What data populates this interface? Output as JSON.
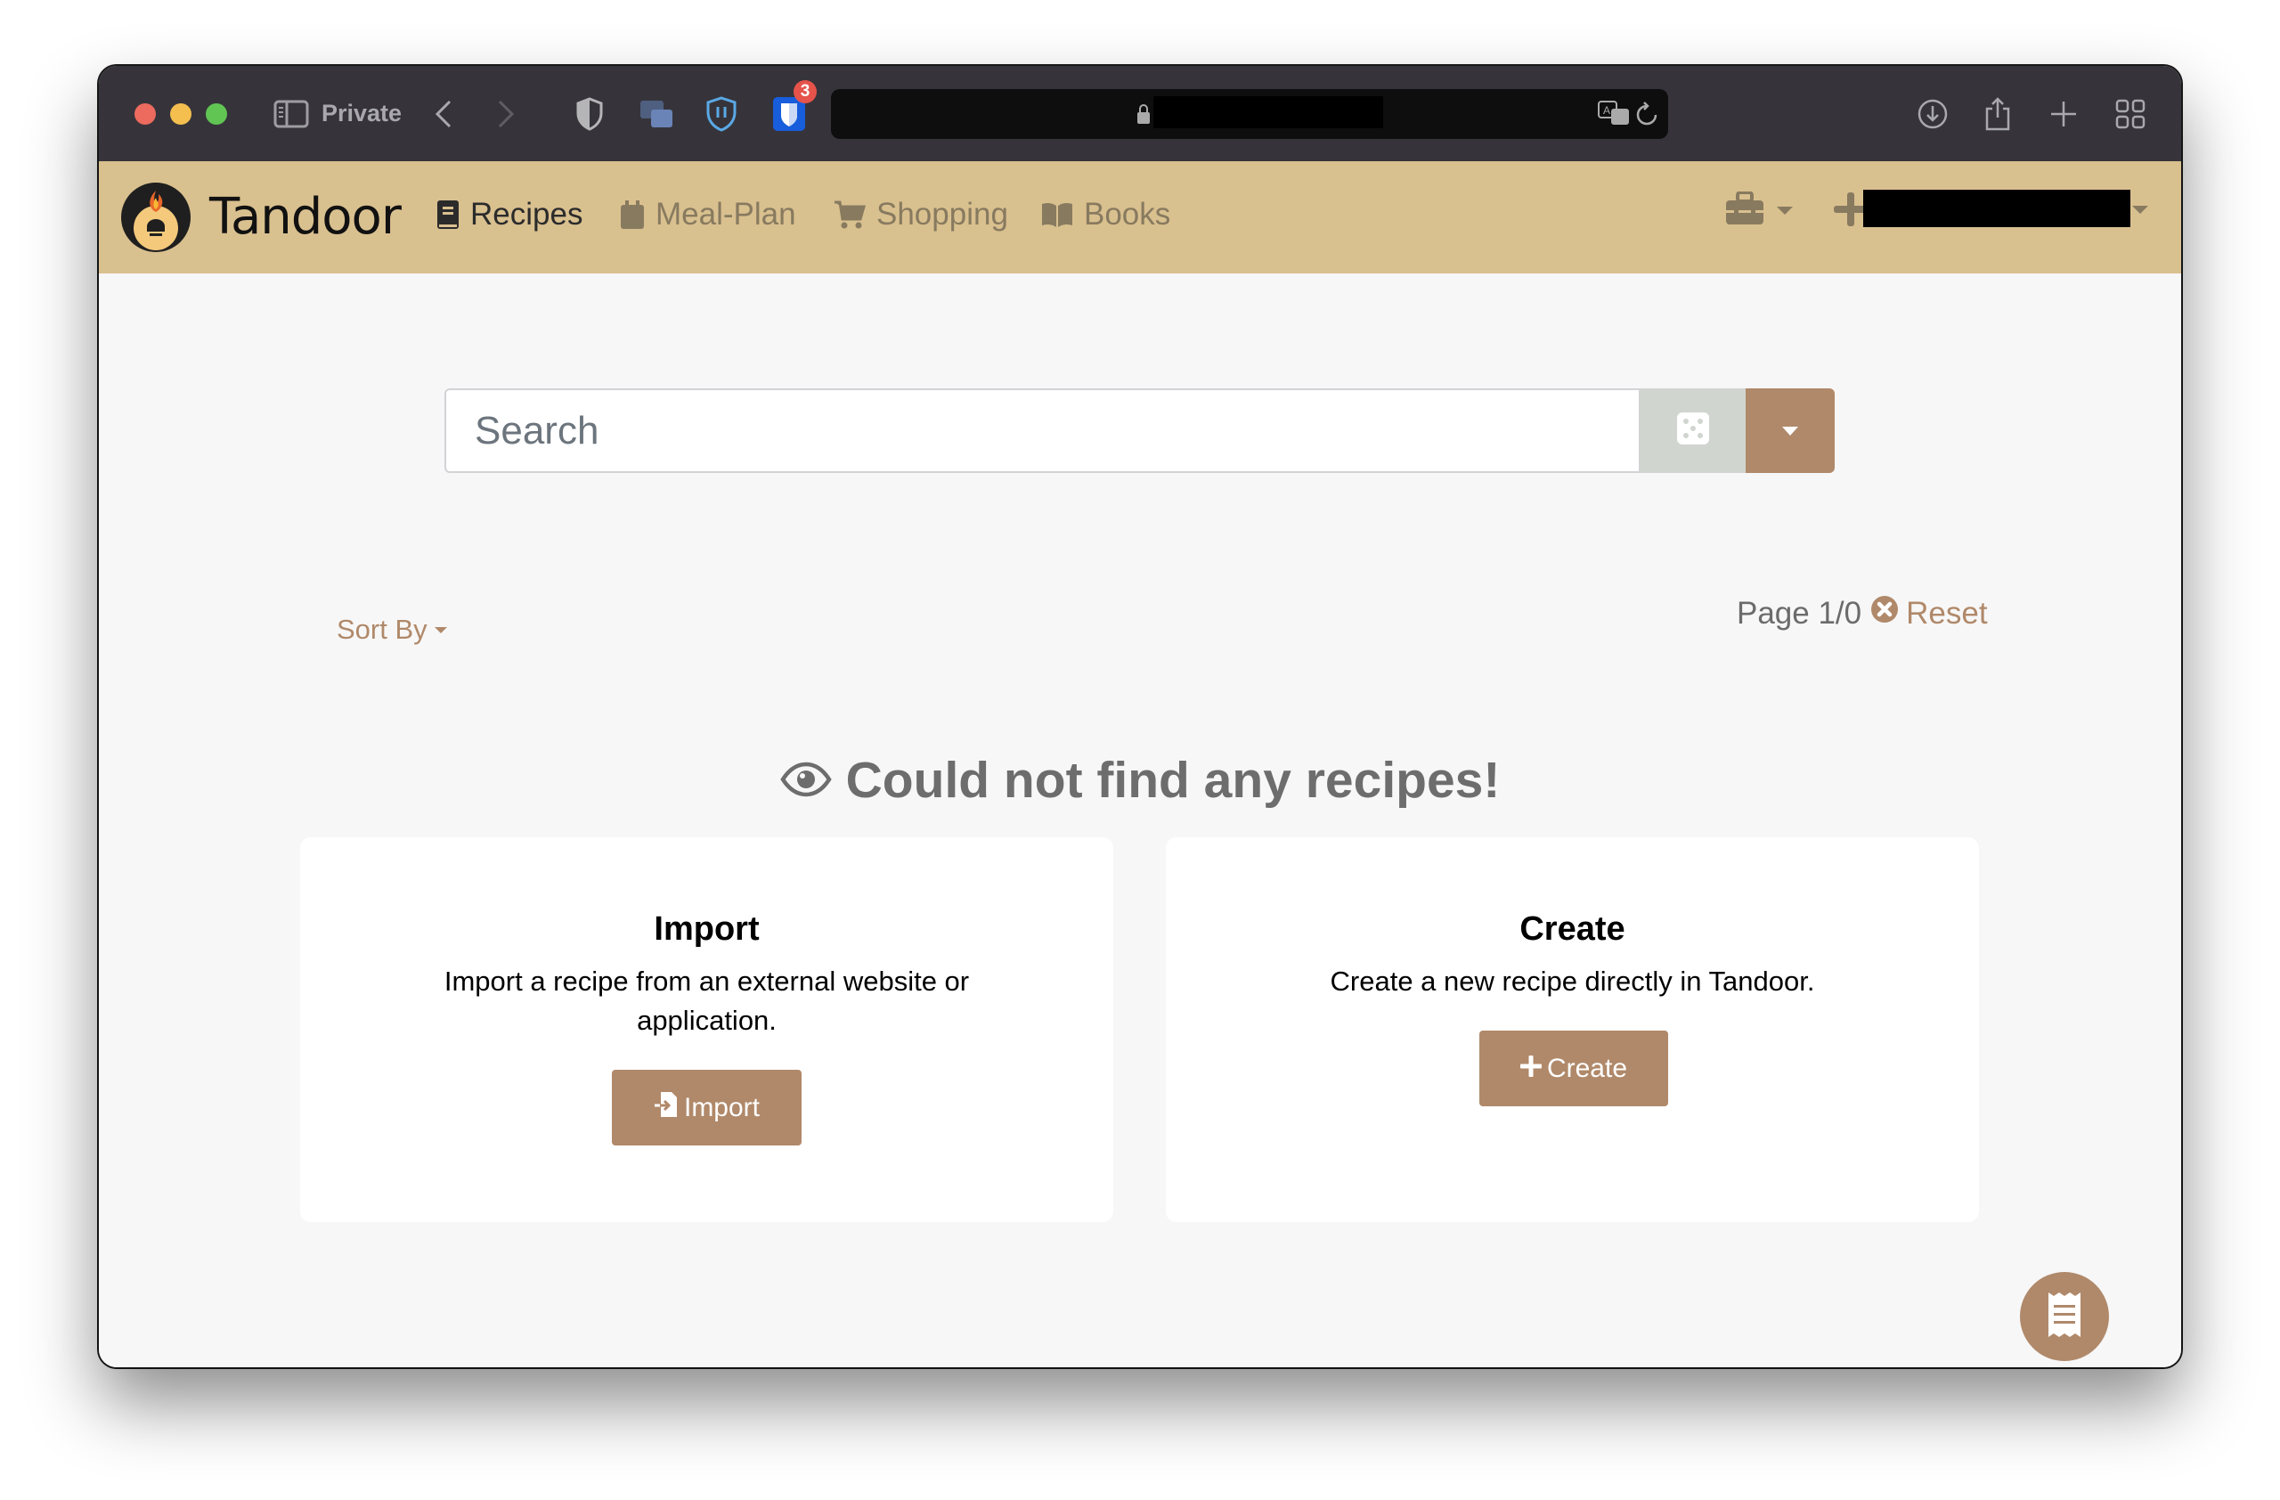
{
  "browser": {
    "private_label": "Private",
    "extension_badge_count": "3",
    "url_redacted": true
  },
  "navbar": {
    "brand": "Tandoor",
    "items": [
      {
        "label": "Recipes",
        "icon": "book-icon",
        "active": true
      },
      {
        "label": "Meal-Plan",
        "icon": "calendar-icon",
        "active": false
      },
      {
        "label": "Shopping",
        "icon": "cart-icon",
        "active": false
      },
      {
        "label": "Books",
        "icon": "open-book-icon",
        "active": false
      }
    ],
    "right": {
      "toolbox_icon": "toolbox-icon",
      "add_icon": "plus-icon",
      "user_icon": "user-icon",
      "username_redacted": true
    }
  },
  "search": {
    "placeholder": "Search",
    "value": "",
    "random_icon": "dice-icon",
    "dropdown_icon": "caret-down-icon"
  },
  "controls": {
    "sort_by_label": "Sort By",
    "page_text": "Page 1/0",
    "reset_label": "Reset"
  },
  "empty_state": {
    "heading": "Could not find any recipes!",
    "cards": [
      {
        "title": "Import",
        "description": "Import a recipe from an external website or application.",
        "button_label": "Import",
        "button_icon": "file-import-icon"
      },
      {
        "title": "Create",
        "description": "Create a new recipe directly in Tandoor.",
        "button_label": "Create",
        "button_icon": "plus-icon"
      }
    ]
  },
  "fab": {
    "icon": "receipt-icon"
  },
  "colors": {
    "navbar_bg": "#d9c08f",
    "primary": "#b0896a",
    "secondary_btn": "#d0d5cf",
    "page_bg": "#f7f7f7",
    "nav_inactive": "#877a5f"
  }
}
